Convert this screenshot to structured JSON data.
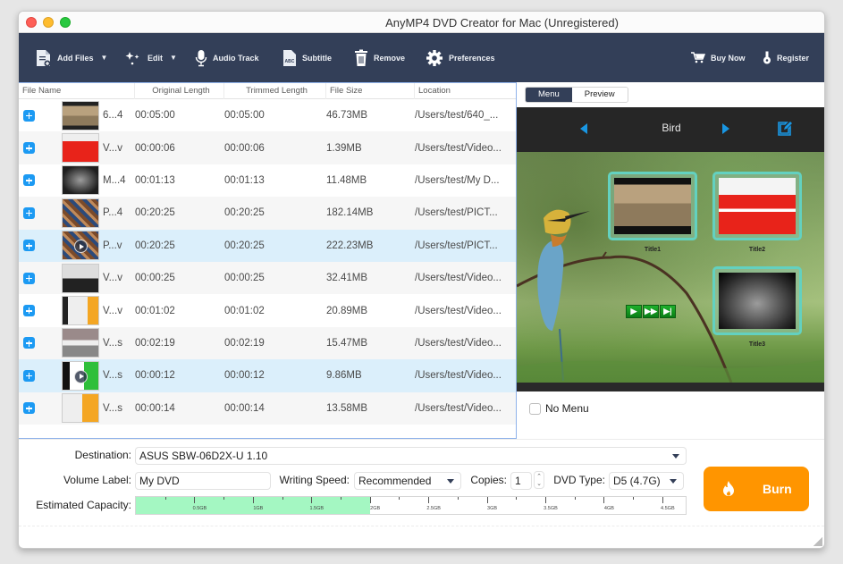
{
  "window": {
    "title": "AnyMP4 DVD Creator for Mac (Unregistered)"
  },
  "toolbar": {
    "add_files": "Add Files",
    "edit": "Edit",
    "audio_track": "Audio Track",
    "subtitle": "Subtitle",
    "remove": "Remove",
    "preferences": "Preferences",
    "buy_now": "Buy Now",
    "register": "Register"
  },
  "file_list": {
    "columns": [
      "File Name",
      "Original Length",
      "Trimmed Length",
      "File Size",
      "Location"
    ],
    "rows": [
      {
        "name": "6...4",
        "original": "00:05:00",
        "trimmed": "00:05:00",
        "size": "46.73MB",
        "location": "/Users/test/640_...",
        "selected": false,
        "playing": false
      },
      {
        "name": "V...v",
        "original": "00:00:06",
        "trimmed": "00:00:06",
        "size": "1.39MB",
        "location": "/Users/test/Video...",
        "selected": false,
        "playing": false
      },
      {
        "name": "M...4",
        "original": "00:01:13",
        "trimmed": "00:01:13",
        "size": "11.48MB",
        "location": "/Users/test/My D...",
        "selected": false,
        "playing": false
      },
      {
        "name": "P...4",
        "original": "00:20:25",
        "trimmed": "00:20:25",
        "size": "182.14MB",
        "location": "/Users/test/PICT...",
        "selected": false,
        "playing": false
      },
      {
        "name": "P...v",
        "original": "00:20:25",
        "trimmed": "00:20:25",
        "size": "222.23MB",
        "location": "/Users/test/PICT...",
        "selected": true,
        "playing": true
      },
      {
        "name": "V...v",
        "original": "00:00:25",
        "trimmed": "00:00:25",
        "size": "32.41MB",
        "location": "/Users/test/Video...",
        "selected": false,
        "playing": false
      },
      {
        "name": "V...v",
        "original": "00:01:02",
        "trimmed": "00:01:02",
        "size": "20.89MB",
        "location": "/Users/test/Video...",
        "selected": false,
        "playing": false
      },
      {
        "name": "V...s",
        "original": "00:02:19",
        "trimmed": "00:02:19",
        "size": "15.47MB",
        "location": "/Users/test/Video...",
        "selected": false,
        "playing": false
      },
      {
        "name": "V...s",
        "original": "00:00:12",
        "trimmed": "00:00:12",
        "size": "9.86MB",
        "location": "/Users/test/Video...",
        "selected": true,
        "playing": true
      },
      {
        "name": "V...s",
        "original": "00:00:14",
        "trimmed": "00:00:14",
        "size": "13.58MB",
        "location": "/Users/test/Video...",
        "selected": false,
        "playing": false
      }
    ]
  },
  "menu_panel": {
    "tabs": [
      {
        "label": "Menu",
        "active": true
      },
      {
        "label": "Preview",
        "active": false
      }
    ],
    "template_name": "Bird",
    "titles": [
      "Title1",
      "Title2",
      "Title3"
    ],
    "no_menu_label": "No Menu",
    "no_menu_checked": false
  },
  "settings": {
    "destination_label": "Destination:",
    "destination_value": "ASUS SBW-06D2X-U 1.10",
    "volume_label_label": "Volume Label:",
    "volume_label_value": "My DVD",
    "writing_speed_label": "Writing Speed:",
    "writing_speed_value": "Recommended",
    "copies_label": "Copies:",
    "copies_value": "1",
    "dvd_type_label": "DVD Type:",
    "dvd_type_value": "D5 (4.7G)",
    "capacity_label": "Estimated Capacity:",
    "capacity_used_gb": 2.0,
    "capacity_max_gb": 4.7,
    "capacity_ticks": [
      "0.5GB",
      "1GB",
      "1.5GB",
      "2GB",
      "2.5GB",
      "3GB",
      "3.5GB",
      "4GB",
      "4.5GB"
    ]
  },
  "burn_button": {
    "label": "Burn"
  },
  "colors": {
    "toolbar": "#333f58",
    "accent_blue": "#1c9af3",
    "burn_orange": "#ff9500",
    "capacity_fill": "#a4f7c2",
    "title_card_border": "#63d1c0"
  }
}
